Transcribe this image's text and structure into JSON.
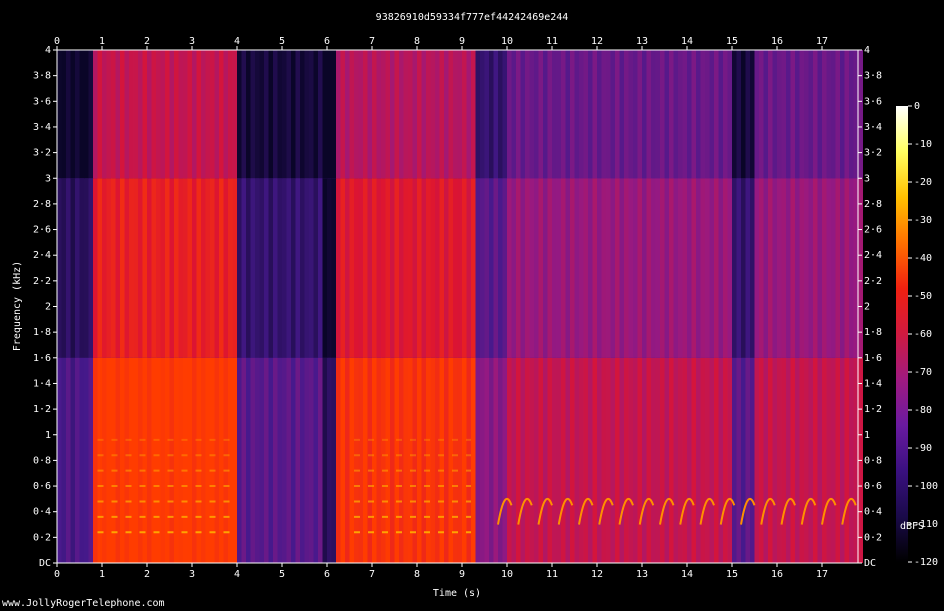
{
  "chart_data": {
    "type": "heatmap",
    "title": "93826910d59334f777ef44242469e244",
    "xlabel": "Time (s)",
    "ylabel": "Frequency (kHz)",
    "xlim": [
      0,
      17.8
    ],
    "ylim": [
      0,
      4
    ],
    "x_ticks": [
      "0",
      "1",
      "2",
      "3",
      "4",
      "5",
      "6",
      "7",
      "8",
      "9",
      "10",
      "11",
      "12",
      "13",
      "14",
      "15",
      "16",
      "17"
    ],
    "y_ticks": [
      "DC",
      "0·2",
      "0·4",
      "0·6",
      "0·8",
      "1",
      "1·2",
      "1·4",
      "1·6",
      "1·8",
      "2",
      "2·2",
      "2·4",
      "2·6",
      "2·8",
      "3",
      "3·2",
      "3·4",
      "3·6",
      "3·8",
      "4"
    ],
    "colorbar": {
      "label": "dBFS",
      "range": [
        -120,
        0
      ],
      "ticks": [
        "0",
        "-10",
        "-20",
        "-30",
        "-40",
        "-50",
        "-60",
        "-70",
        "-80",
        "-90",
        "-100",
        "-110",
        "-120"
      ],
      "colors": [
        "#000000",
        "#1a0a4a",
        "#3a1080",
        "#6a1aa0",
        "#a01a80",
        "#d01a40",
        "#f02010",
        "#ff7000",
        "#ffc000",
        "#ffff60",
        "#ffffff"
      ]
    },
    "grid": false
  },
  "watermark": "www.JollyRogerTelephone.com"
}
